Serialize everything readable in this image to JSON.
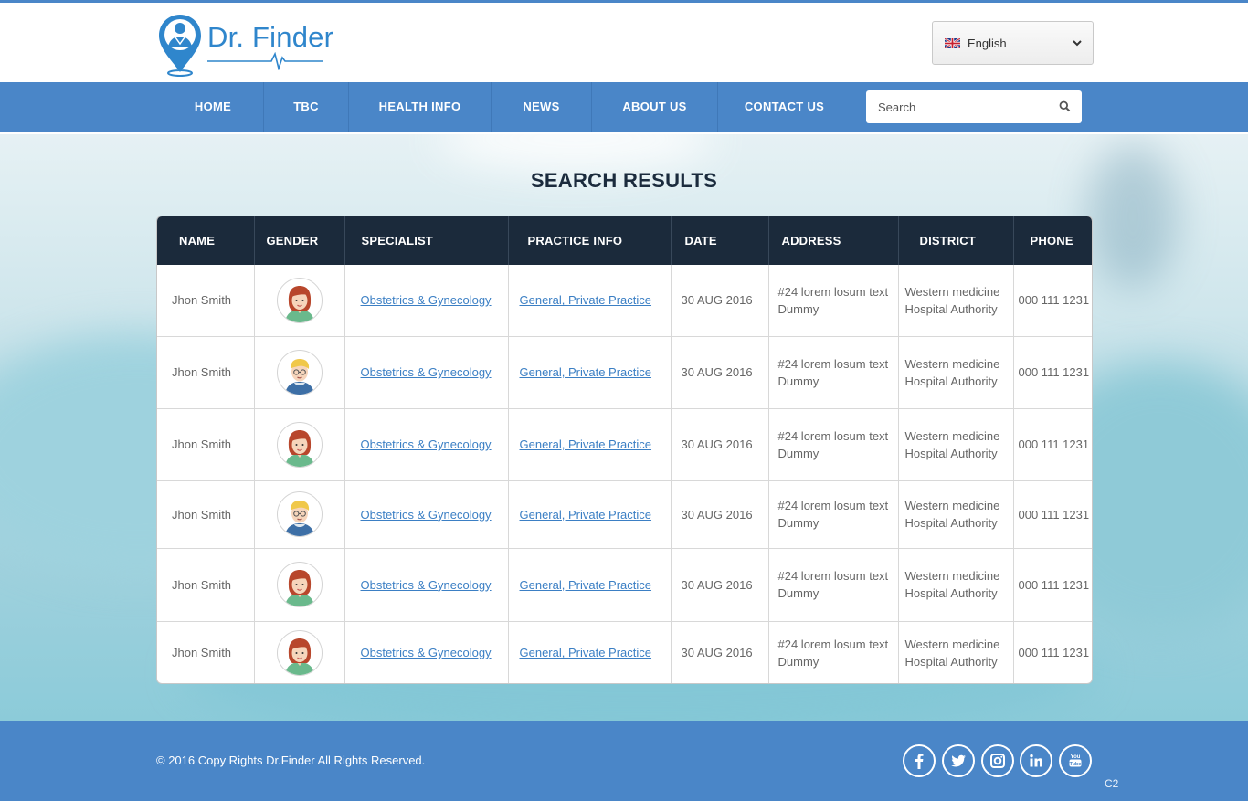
{
  "brand": {
    "name": "Dr. Finder",
    "color": "#2f86cc"
  },
  "language": {
    "selected": "English",
    "flag": "uk-flag-icon"
  },
  "nav": {
    "items": [
      "HOME",
      "TBC",
      "HEALTH INFO",
      "NEWS",
      "ABOUT US",
      "CONTACT US"
    ],
    "search_placeholder": "Search",
    "color": "#4a86c8"
  },
  "page_title": "SEARCH RESULTS",
  "table": {
    "headers": [
      "NAME",
      "GENDER",
      "SPECIALIST",
      "PRACTICE INFO",
      "DATE",
      "ADDRESS",
      "DISTRICT",
      "PHONE"
    ],
    "rows": [
      {
        "name": "Jhon Smith",
        "gender": "female",
        "specialist": "Obstetrics & Gynecology",
        "practice": "General, Private Practice",
        "date": "30 AUG 2016",
        "address": "#24 lorem losum text Dummy",
        "district": "Western medicine Hospital Authority",
        "phone": "000 111 1231"
      },
      {
        "name": "Jhon Smith",
        "gender": "male",
        "specialist": "Obstetrics & Gynecology",
        "practice": "General, Private Practice",
        "date": "30 AUG 2016",
        "address": "#24 lorem losum text Dummy",
        "district": "Western medicine Hospital Authority",
        "phone": "000 111 1231"
      },
      {
        "name": "Jhon Smith",
        "gender": "female",
        "specialist": "Obstetrics & Gynecology",
        "practice": "General, Private Practice",
        "date": "30 AUG 2016",
        "address": "#24 lorem losum text Dummy",
        "district": "Western medicine Hospital Authority",
        "phone": "000 111 1231"
      },
      {
        "name": "Jhon Smith",
        "gender": "male",
        "specialist": "Obstetrics & Gynecology",
        "practice": "General, Private Practice",
        "date": "30 AUG 2016",
        "address": "#24 lorem losum text Dummy",
        "district": "Western medicine Hospital Authority",
        "phone": "000 111 1231"
      },
      {
        "name": "Jhon Smith",
        "gender": "female",
        "specialist": "Obstetrics & Gynecology",
        "practice": "General, Private Practice",
        "date": "30 AUG 2016",
        "address": "#24 lorem losum text Dummy",
        "district": "Western medicine Hospital Authority",
        "phone": "000 111 1231"
      },
      {
        "name": "Jhon Smith",
        "gender": "female",
        "specialist": "Obstetrics & Gynecology",
        "practice": "General, Private Practice",
        "date": "30 AUG 2016",
        "address": "#24 lorem losum text Dummy",
        "district": "Western medicine Hospital Authority",
        "phone": "000 111 1231"
      }
    ]
  },
  "footer": {
    "copyright": "© 2016 Copy Rights Dr.Finder All Rights Reserved.",
    "social": [
      "facebook-icon",
      "twitter-icon",
      "instagram-icon",
      "linkedin-icon",
      "youtube-icon"
    ],
    "corner_label": "C2"
  }
}
